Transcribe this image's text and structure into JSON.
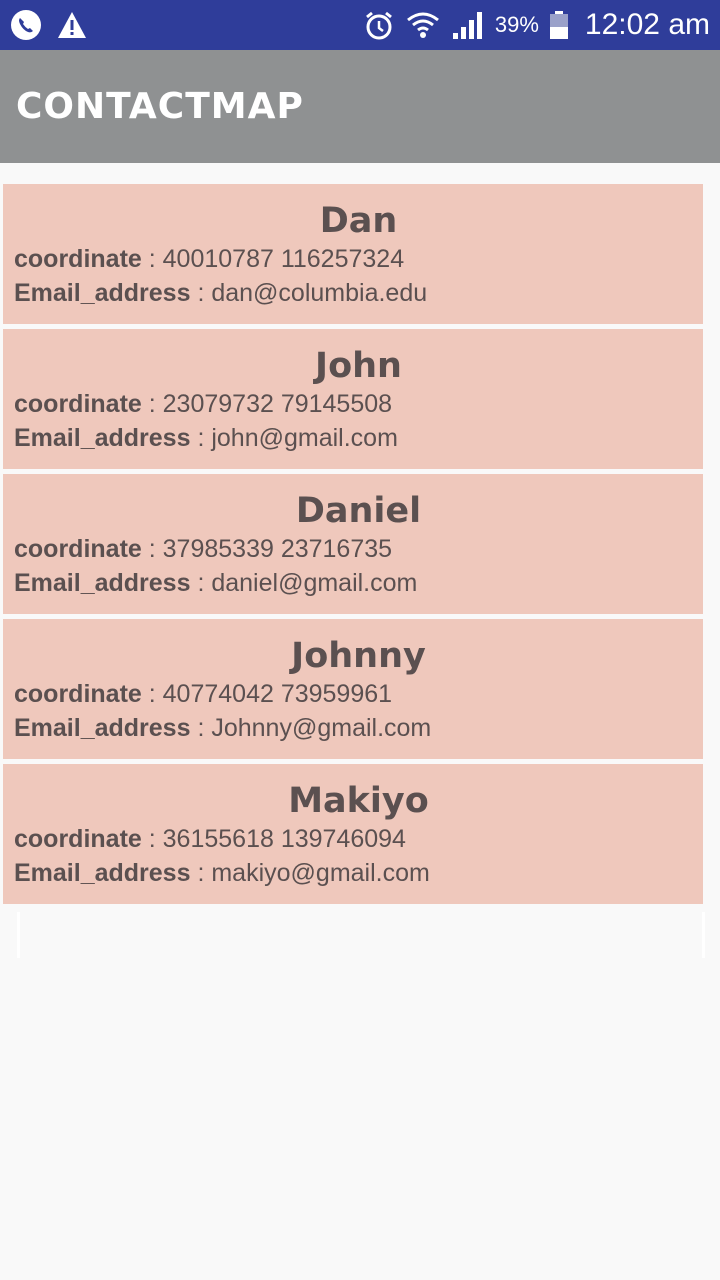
{
  "status_bar": {
    "battery": "39%",
    "time": "12:02 am",
    "left_icons": [
      "phone-call-icon",
      "warning-icon"
    ],
    "right_icons": [
      "alarm-icon",
      "wifi-icon",
      "signal-icon",
      "battery-icon"
    ]
  },
  "app_bar": {
    "title": "CONTACTMAP"
  },
  "labels": {
    "coordinate": "coordinate",
    "coordinate_sep": " : ",
    "email": "Email_address",
    "email_sep": " : "
  },
  "contacts": [
    {
      "name": "Dan",
      "coordinate": "40010787  116257324",
      "email": "dan@columbia.edu"
    },
    {
      "name": "John",
      "coordinate": "23079732 79145508",
      "email": "john@gmail.com"
    },
    {
      "name": "Daniel",
      "coordinate": "37985339  23716735",
      "email": "daniel@gmail.com"
    },
    {
      "name": "Johnny",
      "coordinate": "40774042 73959961",
      "email": "Johnny@gmail.com"
    },
    {
      "name": "Makiyo",
      "coordinate": "36155618 139746094",
      "email": "makiyo@gmail.com"
    }
  ],
  "colors": {
    "status_bar": "#2f3d9a",
    "app_bar": "#8f9192",
    "card": "#efc8bc",
    "card_text": "#5b5050",
    "background": "#f9f9f9"
  }
}
